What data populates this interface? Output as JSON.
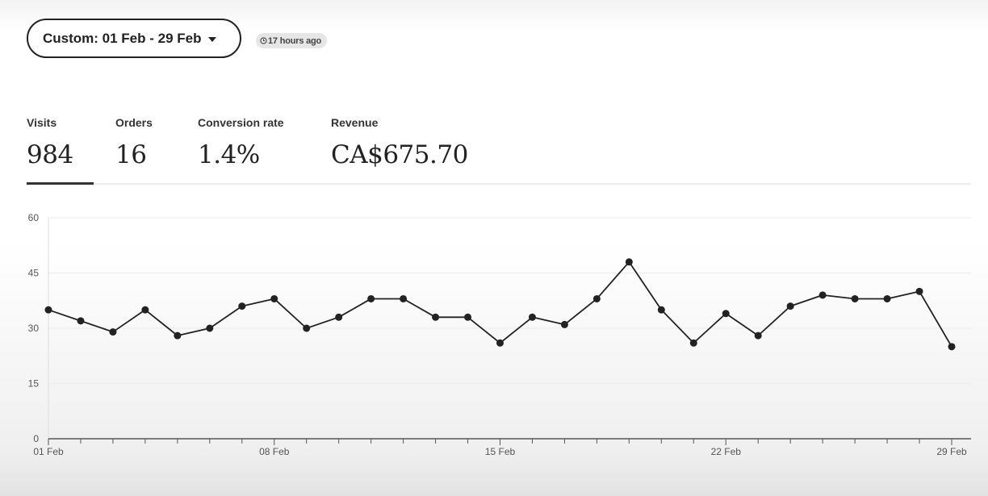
{
  "date_range": {
    "label": "Custom: 01 Feb - 29 Feb"
  },
  "updated": {
    "text": "17 hours ago"
  },
  "metrics": [
    {
      "label": "Visits",
      "value": "984"
    },
    {
      "label": "Orders",
      "value": "16"
    },
    {
      "label": "Conversion rate",
      "value": "1.4%"
    },
    {
      "label": "Revenue",
      "value": "CA$675.70"
    }
  ],
  "chart_data": {
    "type": "line",
    "title": "",
    "xlabel": "",
    "ylabel": "",
    "ylim": [
      0,
      60
    ],
    "yticks": [
      0,
      15,
      30,
      45,
      60
    ],
    "x_tick_labels": [
      {
        "day": 1,
        "label": "01 Feb"
      },
      {
        "day": 8,
        "label": "08 Feb"
      },
      {
        "day": 15,
        "label": "15 Feb"
      },
      {
        "day": 22,
        "label": "22 Feb"
      },
      {
        "day": 29,
        "label": "29 Feb"
      }
    ],
    "x": [
      1,
      2,
      3,
      4,
      5,
      6,
      7,
      8,
      9,
      10,
      11,
      12,
      13,
      14,
      15,
      16,
      17,
      18,
      19,
      20,
      21,
      22,
      23,
      24,
      25,
      26,
      27,
      28,
      29
    ],
    "series": [
      {
        "values": [
          35,
          32,
          29,
          35,
          28,
          30,
          36,
          38,
          30,
          33,
          38,
          38,
          33,
          33,
          26,
          33,
          31,
          38,
          48,
          35,
          26,
          34,
          28,
          36,
          39,
          38,
          38,
          40,
          25
        ]
      }
    ],
    "grid": true,
    "line_color": "#222222"
  }
}
